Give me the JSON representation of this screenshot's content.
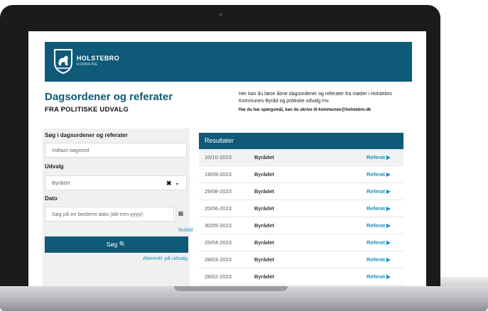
{
  "header": {
    "logo_title": "HOLSTEBRO",
    "logo_subtitle": "KOMMUNE"
  },
  "page": {
    "title": "Dagsordener og referater",
    "subtitle": "FRA POLITISKE UDVALG",
    "intro": "Her kan du læse åbne dagsordener og referater fra møder i Holstebro Kommunes Byråd og politiske udvalg mv.",
    "contact": "Har du har spørgsmål, kan du skrive til kommunen@holstebro.dk"
  },
  "search": {
    "label": "Søg i dagsordener og referater",
    "placeholder": "Indtast søgeord",
    "committee_label": "Udvalg",
    "committee_value": "Byrådet",
    "clear_glyph": "✖",
    "caret_glyph": "▾",
    "date_label": "Dato",
    "date_placeholder": "Søg på en bestemt dato (dd-mm-yyyy)",
    "calendar_glyph": "▦",
    "reset_label": "Nulstil",
    "button_label": "Søg 🔍",
    "subscribe_label": "Abonnér på udvalg"
  },
  "results": {
    "heading": "Resultater",
    "rows": [
      {
        "date": "10/10-2023",
        "body": "Byrådet",
        "link": "Referat ▶"
      },
      {
        "date": "19/09-2023",
        "body": "Byrådet",
        "link": "Referat ▶"
      },
      {
        "date": "29/08-2023",
        "body": "Byrådet",
        "link": "Referat ▶"
      },
      {
        "date": "20/06-2023",
        "body": "Byrådet",
        "link": "Referat ▶"
      },
      {
        "date": "30/05-2023",
        "body": "Byrådet",
        "link": "Referat ▶"
      },
      {
        "date": "25/04-2023",
        "body": "Byrådet",
        "link": "Referat ▶"
      },
      {
        "date": "28/03-2023",
        "body": "Byrådet",
        "link": "Referat ▶"
      },
      {
        "date": "28/02-2023",
        "body": "Byrådet",
        "link": "Referat ▶"
      }
    ]
  },
  "colors": {
    "brand": "#0e5a78",
    "link": "#1a8fbf"
  }
}
